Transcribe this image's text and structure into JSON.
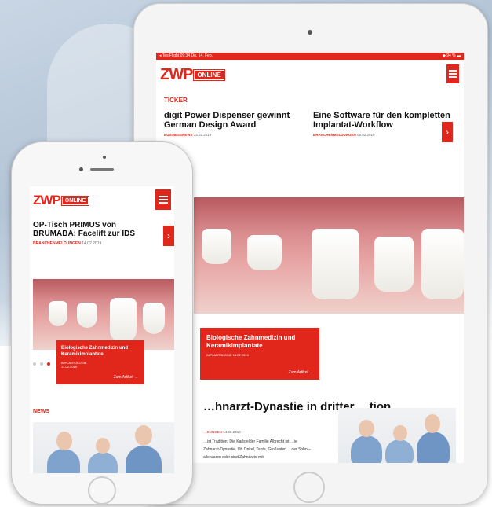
{
  "brand": {
    "logo_main": "ZWP",
    "logo_badge": "ONLINE",
    "accent": "#e1261c"
  },
  "tablet": {
    "status_left": "◂ TestFlight  09:34  Do. 14. Feb.",
    "status_right": "◆ 94 % ▬",
    "ticker_label": "TICKER",
    "ticker": [
      {
        "title": "digit Power Dispenser gewinnt German Design Award",
        "category": "BUSINESSNEWS",
        "date": "13.02.2019"
      },
      {
        "title": "Eine Software für den kompletten Implantat-Workflow",
        "category": "BRANCHENMELDUNGEN",
        "date": "08.02.2019"
      }
    ],
    "featured": {
      "title": "Biologische Zahnmedizin und Keramikimplantate",
      "category": "IMPLANTOLOGIE",
      "date": "14.02.2019",
      "more": "Zum Artikel"
    },
    "article": {
      "title": "…hnarzt-Dynastie in dritter …tion ...",
      "category": "…DUNGEN",
      "date": "14.02.2019",
      "body": "…ist Tradition: Die Karlsfelder Familie Albrecht ist …ie Zahnarzt-Dynastie. Ob Onkel, Tante, Großvater, …der Sohn – alle waren oder sind Zahnärzte mit"
    }
  },
  "phone": {
    "ticker_title": "OP-Tisch PRIMUS von BRUMABA: Facelift zur IDS",
    "ticker_category": "BRANCHENMELDUNGEN",
    "ticker_date": "14.02.2019",
    "featured": {
      "title": "Biologische Zahnmedizin und Keramikimplantate",
      "category": "IMPLANTOLOGIE",
      "date": "14.02.2019",
      "more": "Zum Artikel"
    },
    "news_label": "NEWS"
  }
}
